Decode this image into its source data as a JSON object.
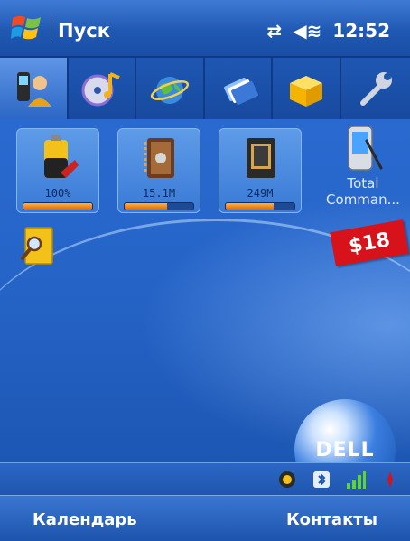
{
  "titlebar": {
    "title": "Пуск",
    "time": "12:52"
  },
  "tabs": [
    {
      "name": "contacts-tab",
      "icon": "phone-contact-icon"
    },
    {
      "name": "media-tab",
      "icon": "cd-music-icon"
    },
    {
      "name": "internet-tab",
      "icon": "globe-icon"
    },
    {
      "name": "cards-tab",
      "icon": "cards-icon"
    },
    {
      "name": "programs-tab",
      "icon": "box-icon"
    },
    {
      "name": "settings-tab",
      "icon": "wrench-icon"
    }
  ],
  "tiles": [
    {
      "value": "100%",
      "fill": 1.0,
      "icon": "battery-icon"
    },
    {
      "value": "15.1M",
      "fill": 0.62,
      "icon": "memory-book-icon"
    },
    {
      "value": "249M",
      "fill": 0.7,
      "icon": "storage-card-icon"
    }
  ],
  "total_commander": {
    "label_line1": "Total",
    "label_line2": "Comman..."
  },
  "price_tag": "$18",
  "brand": "DELL",
  "softkeys": {
    "left": "Календарь",
    "right": "Контакты"
  },
  "colors": {
    "accent": "#1f5bb8",
    "price": "#d8121b",
    "bar_fill": "#e06c00"
  }
}
